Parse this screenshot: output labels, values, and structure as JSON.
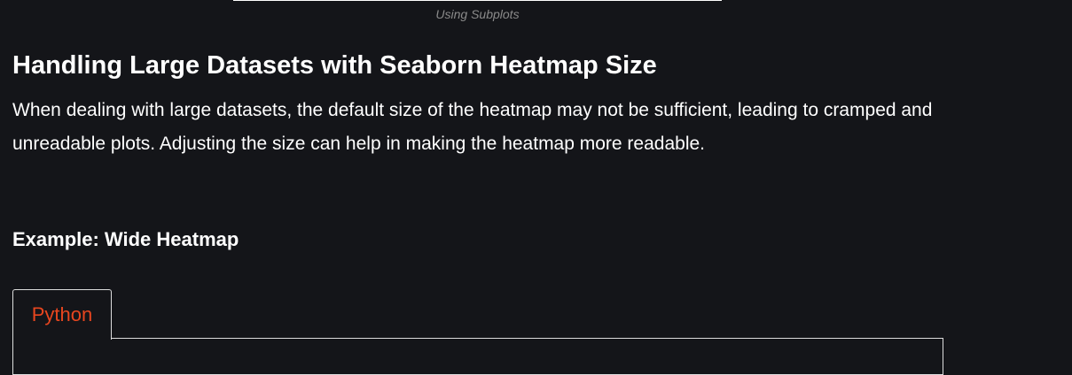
{
  "caption": "Using Subplots",
  "heading": "Handling Large Datasets with Seaborn Heatmap Size",
  "paragraph": "When dealing with large datasets, the default size of the heatmap may not be sufficient, leading to cramped and unreadable plots. Adjusting the size can help in making the heatmap more readable.",
  "subheading": "Example: Wide Heatmap",
  "tabs": [
    {
      "label": "Python"
    }
  ]
}
